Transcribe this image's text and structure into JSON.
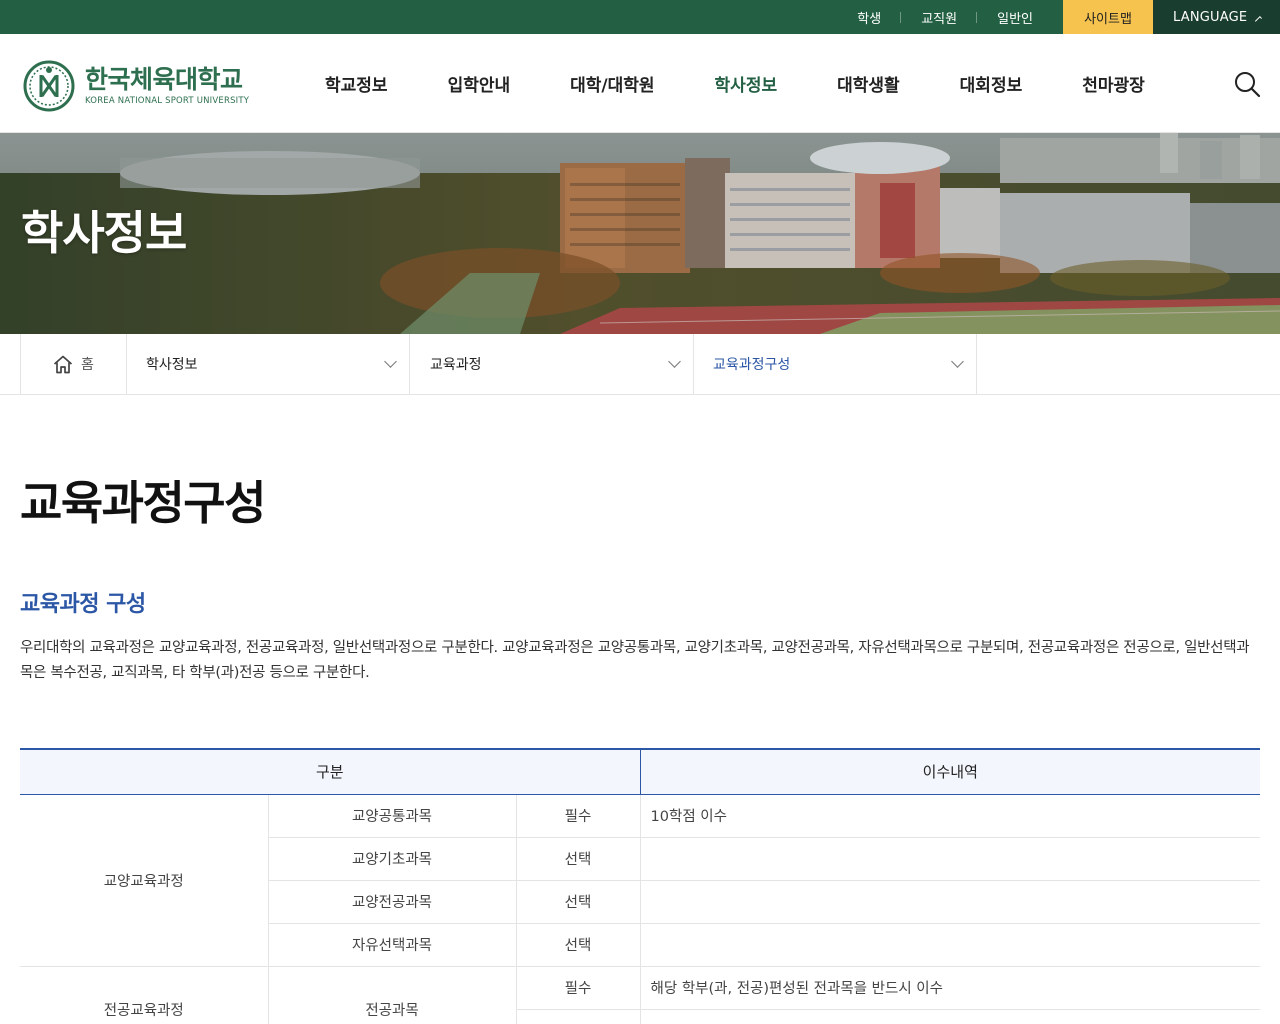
{
  "topbar": {
    "links": [
      "학생",
      "교직원",
      "일반인"
    ],
    "sitemap": "사이트맵",
    "language": "LANGUAGE"
  },
  "logo": {
    "name_ko": "한국체육대학교",
    "name_en": "KOREA NATIONAL SPORT UNIVERSITY"
  },
  "gnb": {
    "items": [
      "학교정보",
      "입학안내",
      "대학/대학원",
      "학사정보",
      "대학생활",
      "대회정보",
      "천마광장"
    ],
    "active": "학사정보"
  },
  "visual": {
    "title": "학사정보"
  },
  "breadcrumb": {
    "home": "홈",
    "level1": "학사정보",
    "level2": "교육과정",
    "level3": "교육과정구성"
  },
  "page": {
    "title": "교육과정구성",
    "section_title": "교육과정 구성",
    "description": "우리대학의 교육과정은 교양교육과정, 전공교육과정, 일반선택과정으로 구분한다. 교양교육과정은 교양공통과목, 교양기초과목, 교양전공과목, 자유선택과목으로 구분되며, 전공교육과정은 전공으로, 일반선택과목은 복수전공, 교직과목, 타 학부(과)전공 등으로 구분한다."
  },
  "table": {
    "headers": [
      "구분",
      "이수내역"
    ],
    "groups": [
      {
        "name": "교양교육과정",
        "rows": [
          {
            "course": "교양공통과목",
            "type": "필수",
            "detail": "10학점 이수"
          },
          {
            "course": "교양기초과목",
            "type": "선택",
            "detail": ""
          },
          {
            "course": "교양전공과목",
            "type": "선택",
            "detail": ""
          },
          {
            "course": "자유선택과목",
            "type": "선택",
            "detail": ""
          }
        ]
      },
      {
        "name": "전공교육과정",
        "course": "전공과목",
        "rows": [
          {
            "type": "필수",
            "detail": "해당 학부(과, 전공)편성된 전과목을 반드시 이수"
          }
        ]
      }
    ]
  },
  "colors": {
    "topbar": "#236043",
    "accent_yellow": "#f6c34f",
    "language_bg": "#193d2e",
    "brand_green": "#2d6f4f",
    "link_blue": "#2b57a6"
  },
  "icons": [
    "home-icon",
    "search-icon",
    "chevron-down-icon",
    "chevron-up-icon"
  ]
}
